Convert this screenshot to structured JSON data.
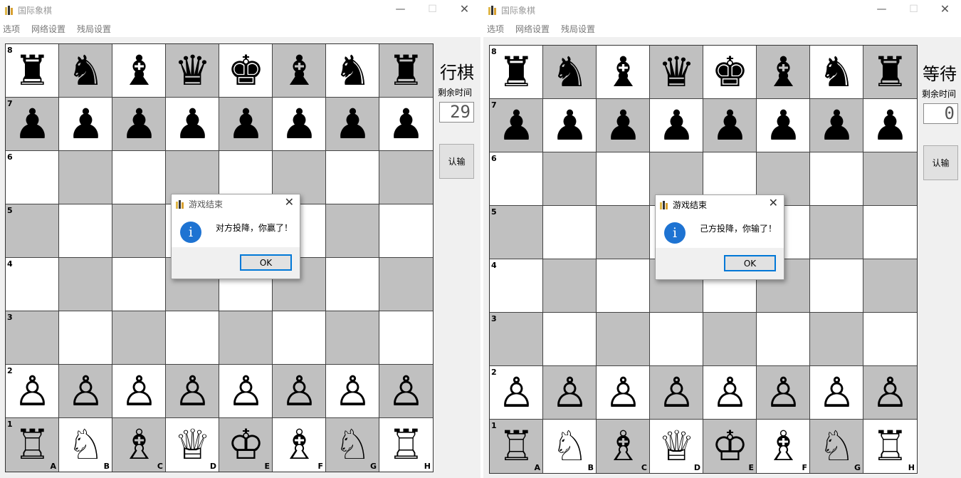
{
  "left_window": {
    "title": "国际象棋",
    "menu": [
      "选项",
      "网络设置",
      "残局设置"
    ],
    "status": "行棋",
    "time_label": "剩余时间",
    "time_value": "29",
    "resign_label": "认输",
    "dialog": {
      "title": "游戏结束",
      "message": "对方投降，你赢了！",
      "ok_label": "OK"
    }
  },
  "right_window": {
    "title": "国际象棋",
    "menu": [
      "选项",
      "网络设置",
      "残局设置"
    ],
    "status": "等待",
    "time_label": "剩余时间",
    "time_value": "0",
    "resign_label": "认输",
    "dialog": {
      "title": "游戏结束",
      "message": "己方投降，你输了！",
      "ok_label": "OK"
    }
  },
  "board": {
    "ranks": [
      "8",
      "7",
      "6",
      "5",
      "4",
      "3",
      "2",
      "1"
    ],
    "files": [
      "A",
      "B",
      "C",
      "D",
      "E",
      "F",
      "G",
      "H"
    ],
    "rows": [
      [
        "black-rook",
        "black-knight",
        "black-bishop",
        "black-queen",
        "black-king",
        "black-bishop",
        "black-knight",
        "black-rook"
      ],
      [
        "black-pawn",
        "black-pawn",
        "black-pawn",
        "black-pawn",
        "black-pawn",
        "black-pawn",
        "black-pawn",
        "black-pawn"
      ],
      [
        "",
        "",
        "",
        "",
        "",
        "",
        "",
        ""
      ],
      [
        "",
        "",
        "",
        "",
        "",
        "",
        "",
        ""
      ],
      [
        "",
        "",
        "",
        "",
        "",
        "",
        "",
        ""
      ],
      [
        "",
        "",
        "",
        "",
        "",
        "",
        "",
        ""
      ],
      [
        "white-pawn",
        "white-pawn",
        "white-pawn",
        "white-pawn",
        "white-pawn",
        "white-pawn",
        "white-pawn",
        "white-pawn"
      ],
      [
        "white-rook",
        "white-knight",
        "white-bishop",
        "white-queen",
        "white-king",
        "white-bishop",
        "white-knight",
        "white-rook"
      ]
    ]
  },
  "colors": {
    "light_square": "#ffffff",
    "dark_square": "#c0c0c0",
    "info_icon": "#1e73d2",
    "ok_border": "#0078d7"
  }
}
